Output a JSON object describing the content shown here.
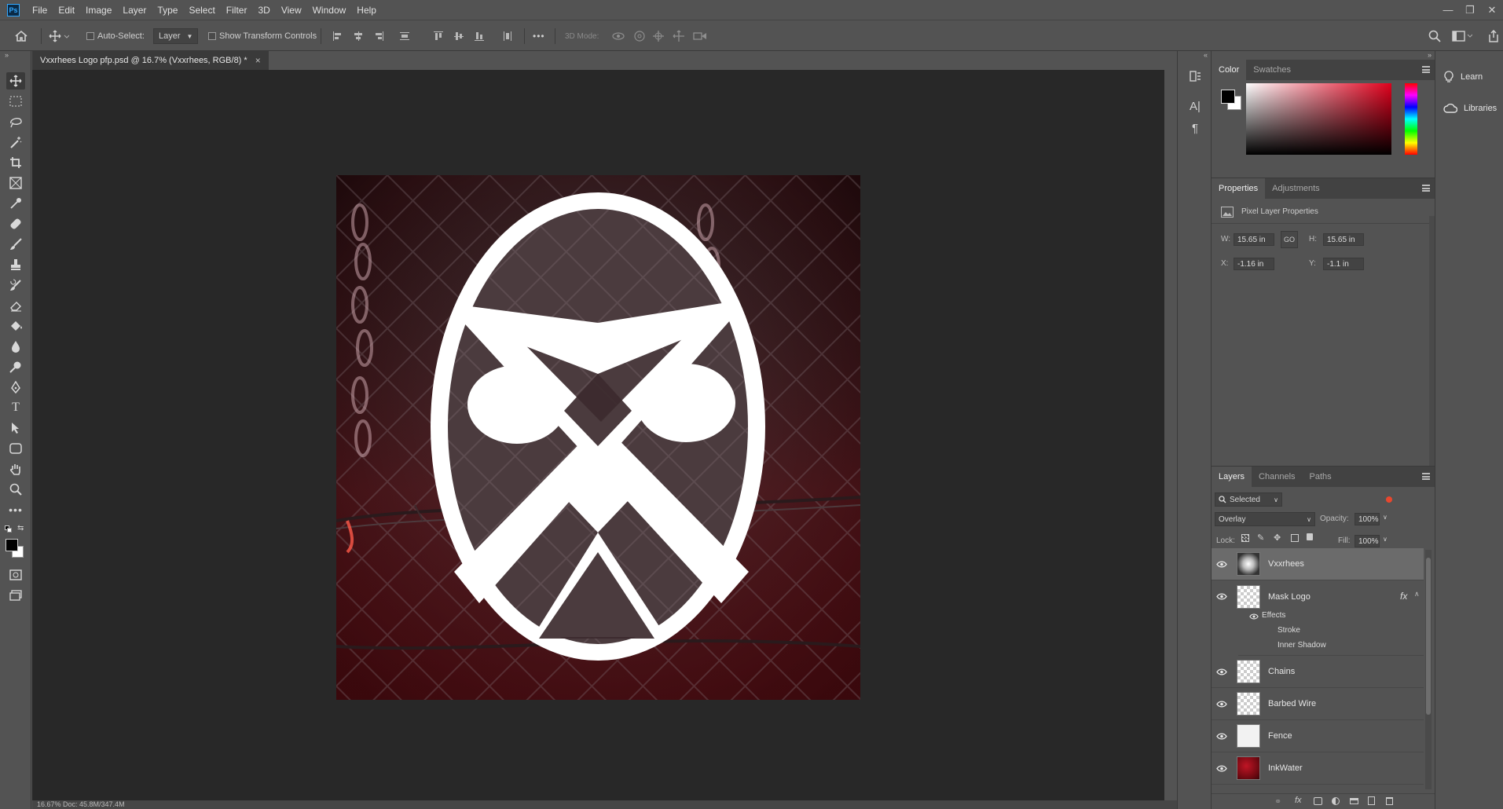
{
  "app": {
    "logo_text": "Ps",
    "menu": [
      "File",
      "Edit",
      "Image",
      "Layer",
      "Type",
      "Select",
      "Filter",
      "3D",
      "View",
      "Window",
      "Help"
    ],
    "window_controls": [
      "—",
      "❐",
      "✕"
    ]
  },
  "options_bar": {
    "auto_select_label": "Auto-Select:",
    "auto_select_target": "Layer",
    "show_transform_label": "Show Transform Controls",
    "more_label": "•••",
    "mode_3d_label": "3D Mode:"
  },
  "document": {
    "tab_title": "Vxxrhees Logo pfp.psd @ 16.7% (Vxxrhees, RGB/8) *",
    "close_glyph": "×",
    "status_text": "16.67%     Doc: 45.8M/347.4M"
  },
  "color_panel": {
    "tabs": [
      "Color",
      "Swatches"
    ],
    "active_tab": "Color",
    "foreground": "#000000",
    "background": "#ffffff",
    "hue_color": "#e0001c"
  },
  "properties_panel": {
    "tabs": [
      "Properties",
      "Adjustments"
    ],
    "active_tab": "Properties",
    "title": "Pixel Layer Properties",
    "w_label": "W:",
    "w_value": "15.65 in",
    "h_label": "H:",
    "h_value": "15.65 in",
    "x_label": "X:",
    "x_value": "-1.16 in",
    "y_label": "Y:",
    "y_value": "-1.1 in",
    "link_glyph": "GO"
  },
  "layers_panel": {
    "tabs": [
      "Layers",
      "Channels",
      "Paths"
    ],
    "active_tab": "Layers",
    "filter_value": "Selected",
    "blend_mode": "Overlay",
    "opacity_label": "Opacity:",
    "opacity_value": "100%",
    "lock_label": "Lock:",
    "fill_label": "Fill:",
    "fill_value": "100%",
    "layers": [
      {
        "name": "Vxxrhees",
        "selected": true
      },
      {
        "name": "Mask Logo",
        "selected": false,
        "fx": "fx"
      },
      {
        "name": "Chains",
        "selected": false
      },
      {
        "name": "Barbed Wire",
        "selected": false
      },
      {
        "name": "Fence",
        "selected": false
      },
      {
        "name": "InkWater",
        "selected": false
      }
    ],
    "effects_label": "Effects",
    "effects": [
      "Stroke",
      "Inner Shadow"
    ]
  },
  "side_column": {
    "learn_label": "Learn",
    "libraries_label": "Libraries"
  }
}
